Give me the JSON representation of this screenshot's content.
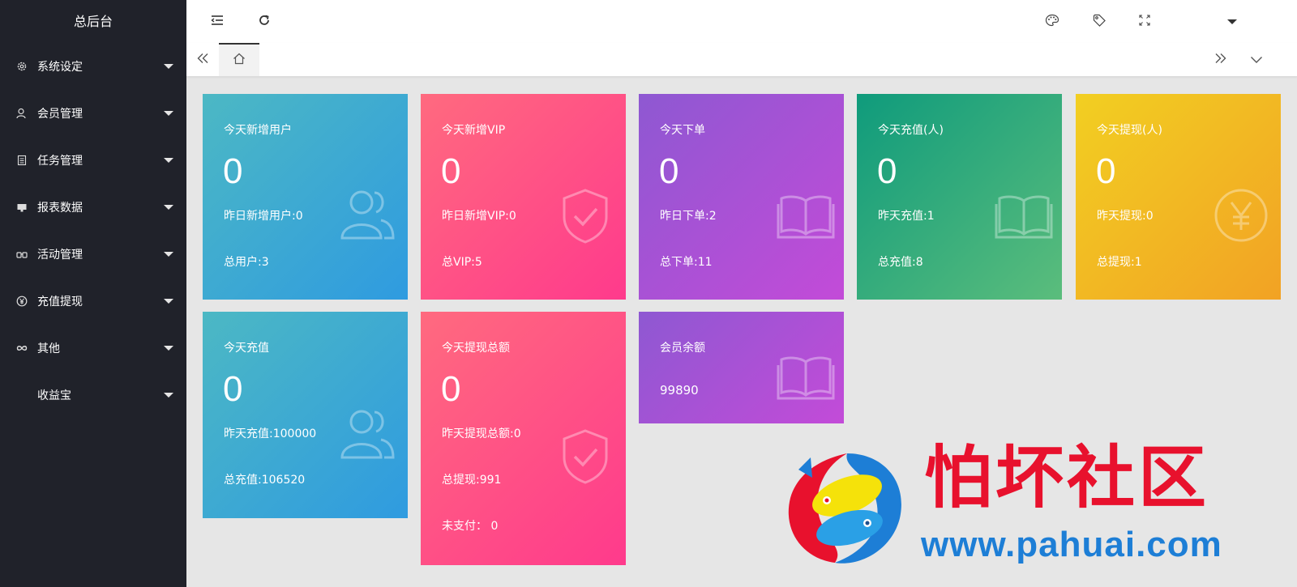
{
  "sidebar": {
    "title": "总后台",
    "items": [
      {
        "label": "系统设定",
        "icon": "gear-icon"
      },
      {
        "label": "会员管理",
        "icon": "user-icon"
      },
      {
        "label": "任务管理",
        "icon": "document-icon"
      },
      {
        "label": "报表数据",
        "icon": "report-icon"
      },
      {
        "label": "活动管理",
        "icon": "binoculars-icon"
      },
      {
        "label": "充值提现",
        "icon": "yen-icon"
      },
      {
        "label": "其他",
        "icon": "infinity-icon"
      },
      {
        "label": "收益宝",
        "icon": ""
      }
    ]
  },
  "header": {
    "icons": [
      "menu-collapse-icon",
      "refresh-icon",
      "palette-icon",
      "tag-icon",
      "fullscreen-icon",
      "dropdown-caret-icon"
    ]
  },
  "tabs": {
    "home_icon": "home-icon"
  },
  "cards": [
    {
      "title": "今天新增用户",
      "value": "0",
      "line1": "昨日新增用户:0",
      "line2": "总用户:3",
      "icon": "users-icon",
      "color": "blue"
    },
    {
      "title": "今天新增VIP",
      "value": "0",
      "line1": "昨日新增VIP:0",
      "line2": "总VIP:5",
      "icon": "shield-check-icon",
      "color": "pink"
    },
    {
      "title": "今天下单",
      "value": "0",
      "line1": "昨日下单:2",
      "line2": "总下单:11",
      "icon": "book-icon",
      "color": "purple"
    },
    {
      "title": "今天充值(人)",
      "value": "0",
      "line1": "昨天充值:1",
      "line2": "总充值:8",
      "icon": "book-icon",
      "color": "green"
    },
    {
      "title": "今天提现(人)",
      "value": "0",
      "line1": "昨天提现:0",
      "line2": "总提现:1",
      "icon": "yen-circle-icon",
      "color": "orange"
    },
    {
      "title": "今天充值",
      "value": "0",
      "line1": "昨天充值:100000",
      "line2": "总充值:106520",
      "icon": "users-icon",
      "color": "blue"
    },
    {
      "title": "今天提现总额",
      "value": "0",
      "line1": "昨天提现总额:0",
      "line2": "总提现:991",
      "line3": "未支付： 0",
      "icon": "shield-check-icon",
      "color": "pink"
    },
    {
      "title": "会员余额",
      "value_small": "99890",
      "icon": "book-icon",
      "color": "purple"
    }
  ],
  "watermark": {
    "title": "怕坏社区",
    "url": "www.pahuai.com"
  }
}
